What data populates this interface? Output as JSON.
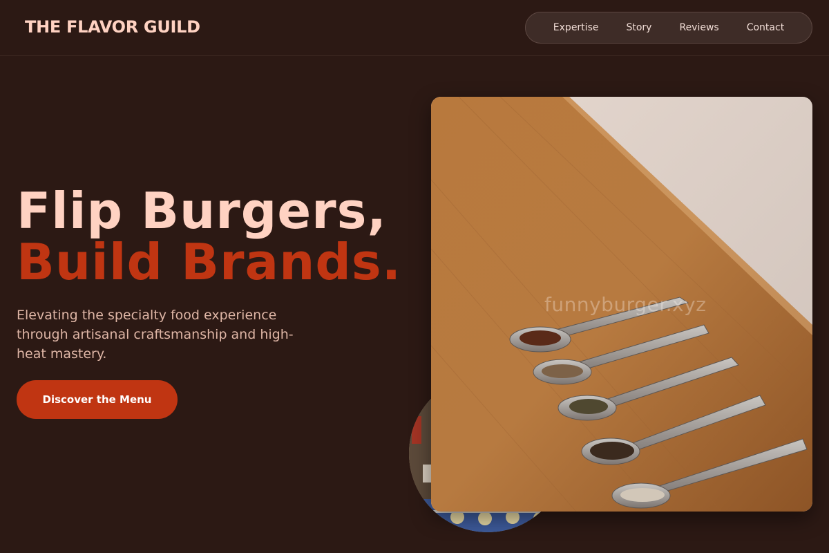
{
  "header": {
    "logo": "THE FLAVOR GUILD",
    "nav": [
      {
        "label": "Expertise"
      },
      {
        "label": "Story"
      },
      {
        "label": "Reviews"
      },
      {
        "label": "Contact"
      }
    ]
  },
  "hero": {
    "title_line1": "Flip Burgers,",
    "title_line2": "Build Brands.",
    "subtitle": "Elevating the specialty food experience through artisanal craftsmanship and high-heat mastery.",
    "cta_label": "Discover the Menu"
  },
  "images": {
    "main_alt": "Five metal spoons with spices on a wooden table",
    "circle_alt": "Decorative tiled interior",
    "watermark": "funnyburger.xyz"
  },
  "colors": {
    "background": "#2c1914",
    "accent": "#c03512",
    "light_text": "#ffd2c2",
    "muted_text": "#dfb6a6"
  }
}
